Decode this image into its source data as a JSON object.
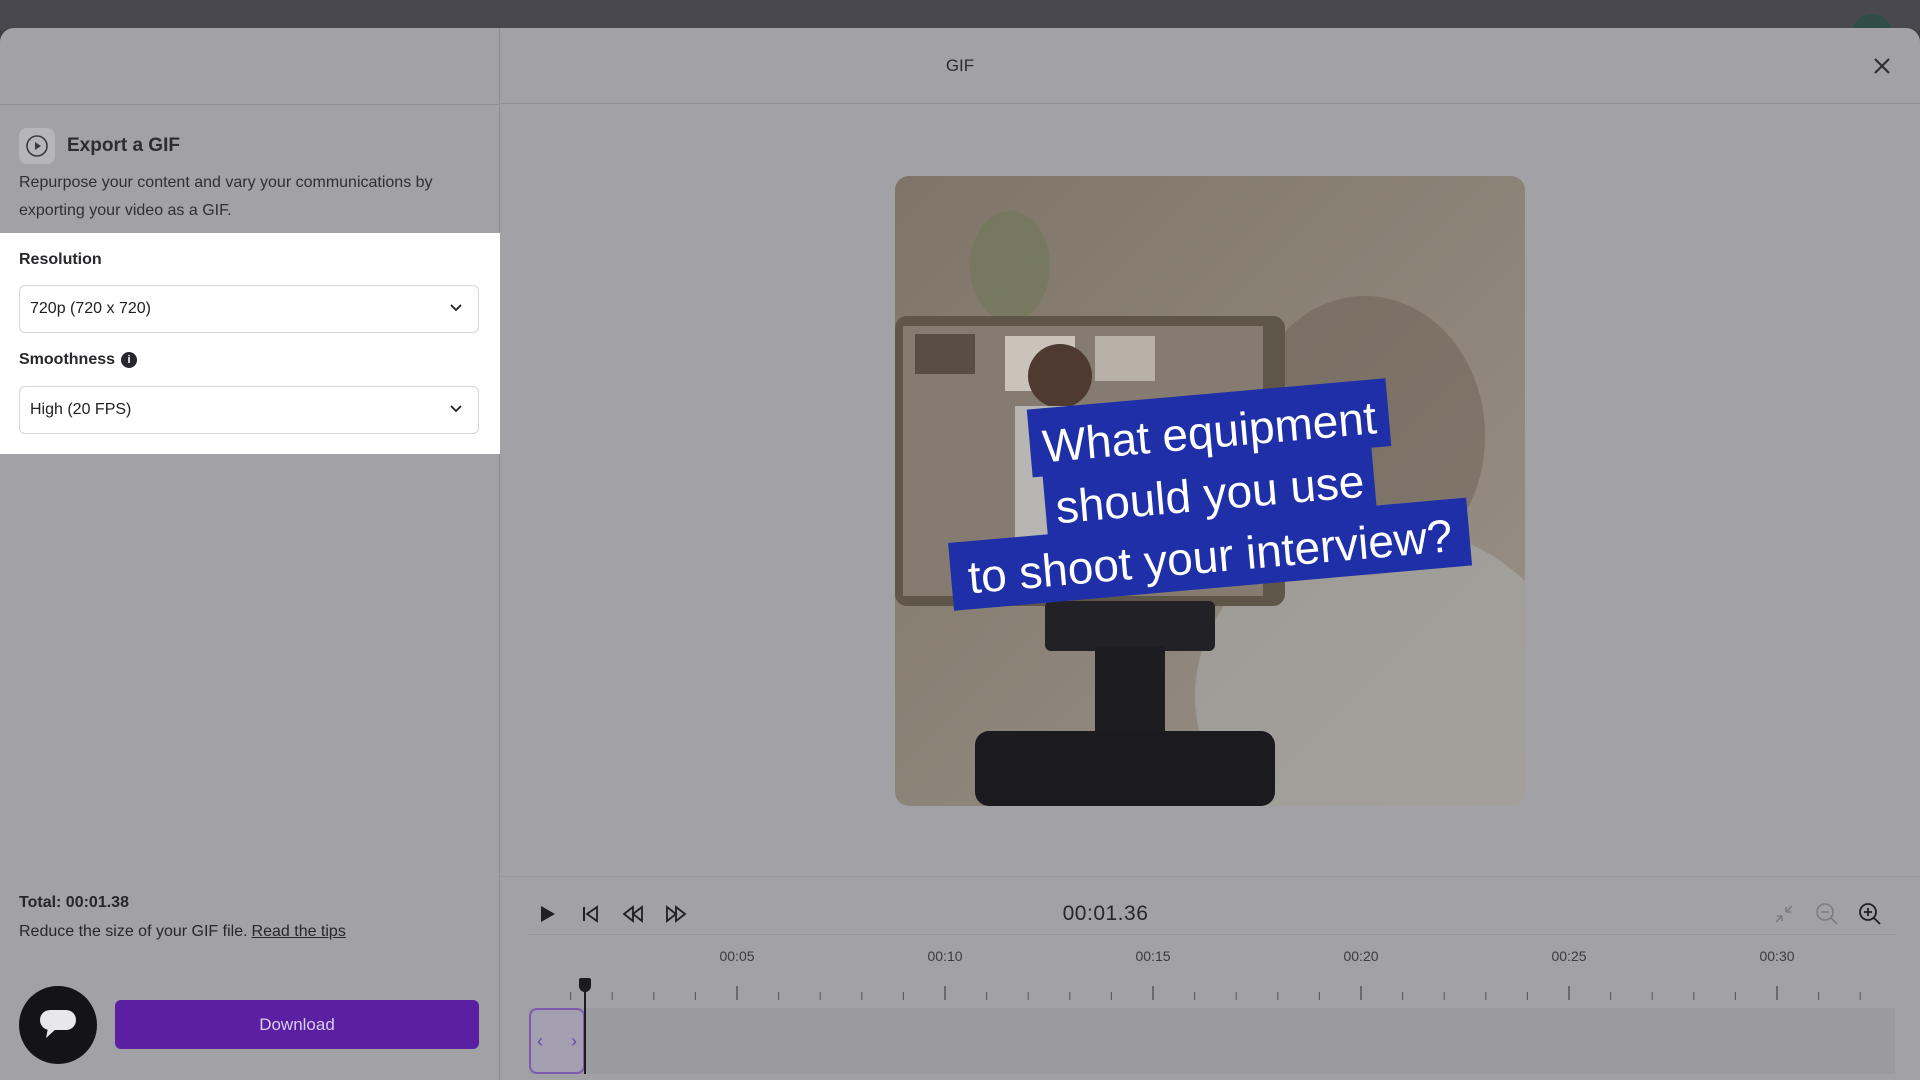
{
  "modal": {
    "title": "GIF"
  },
  "export": {
    "title": "Export a GIF",
    "description": "Repurpose your content and vary your communications by exporting your video as a GIF."
  },
  "resolution": {
    "label": "Resolution",
    "value": "720p (720 x 720)"
  },
  "smoothness": {
    "label": "Smoothness",
    "value": "High (20 FPS)"
  },
  "summary": {
    "total": "Total: 00:01.38",
    "reduce_text": "Reduce the size of your GIF file.",
    "tips_link": "Read the tips"
  },
  "download_label": "Download",
  "player": {
    "timecode": "00:01.36"
  },
  "timeline": {
    "labels": [
      "00:05",
      "00:10",
      "00:15",
      "00:20",
      "00:25",
      "00:30"
    ],
    "selection_start_seconds": 0,
    "selection_end_seconds": 1.38,
    "playhead_seconds": 1.36
  },
  "video": {
    "caption_lines": [
      "What equipment",
      "should you use",
      "to shoot your interview?"
    ]
  },
  "colors": {
    "accent": "#5b1fa3",
    "caption_bg": "#1f2fa8",
    "overlay": "#a1a1a6"
  },
  "icons": {
    "export": "play-circle-icon",
    "info": "info-icon",
    "chevron": "chevron-down-icon",
    "close": "close-icon",
    "play": "play-icon",
    "skip_start": "skip-to-start-icon",
    "rewind": "rewind-icon",
    "fast_forward": "fast-forward-icon",
    "shrink": "shrink-icon",
    "zoom_out": "zoom-out-icon",
    "zoom_in": "zoom-in-icon",
    "chat": "chat-icon"
  }
}
